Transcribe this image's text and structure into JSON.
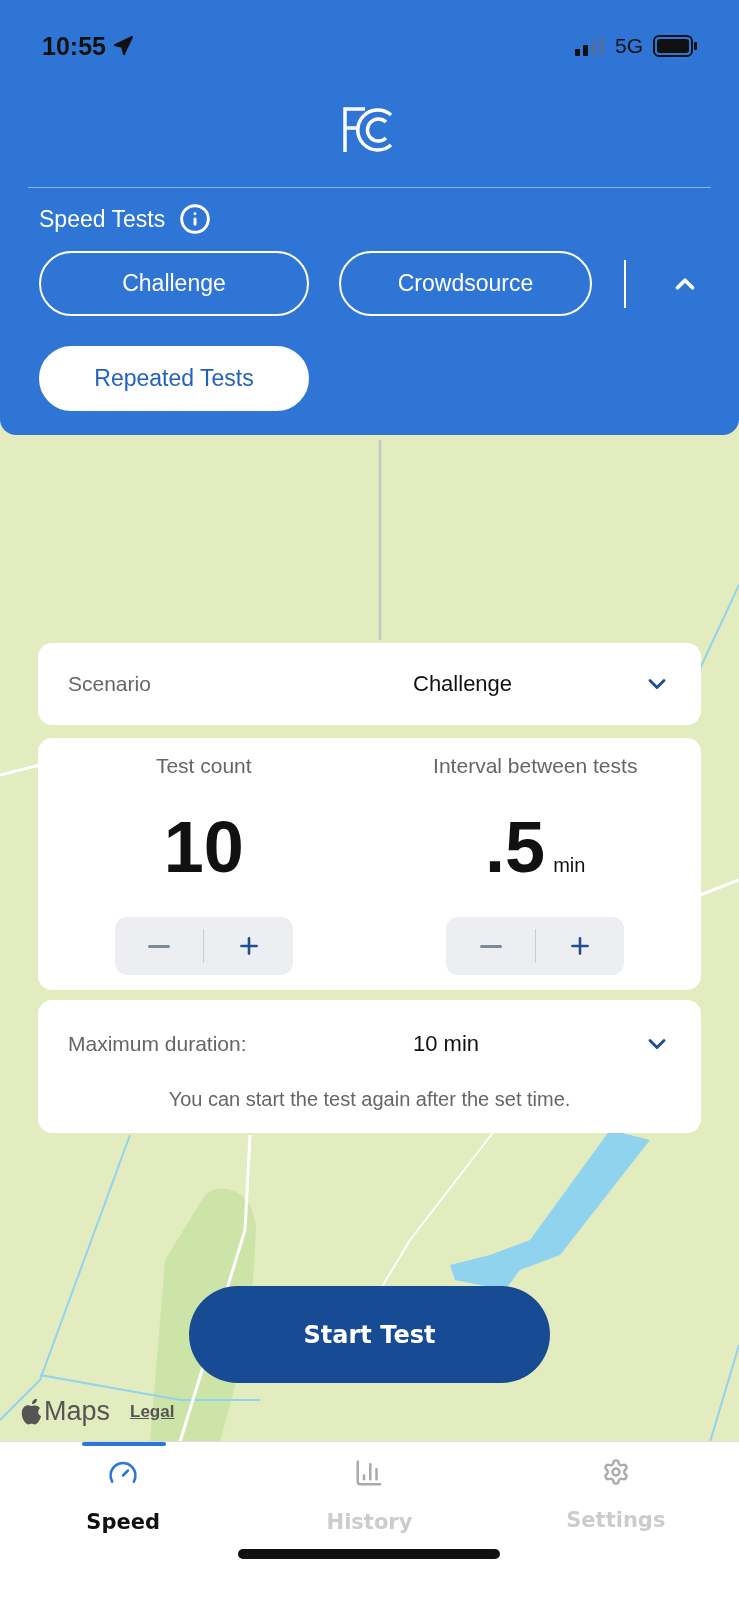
{
  "status_bar": {
    "time": "10:55",
    "network": "5G"
  },
  "header": {
    "section_title": "Speed Tests",
    "expanded": true,
    "test_types": [
      {
        "label": "Challenge",
        "selected": false
      },
      {
        "label": "Crowdsource",
        "selected": false
      },
      {
        "label": "Repeated Tests",
        "selected": true
      }
    ]
  },
  "map": {
    "attribution": "Maps",
    "legal": "Legal"
  },
  "scenario": {
    "label": "Scenario",
    "value": "Challenge"
  },
  "counters": [
    {
      "label": "Test count",
      "value": "10"
    },
    {
      "label": "Interval between tests",
      "value": ".5",
      "unit": "min"
    }
  ],
  "duration": {
    "label": "Maximum duration:",
    "value": "10 min",
    "note": "You can start the test again after the set time."
  },
  "start_button": "Start Test",
  "tabs": [
    {
      "label": "Speed",
      "selected": true
    },
    {
      "label": "History",
      "selected": false
    },
    {
      "label": "Settings",
      "selected": false
    }
  ]
}
